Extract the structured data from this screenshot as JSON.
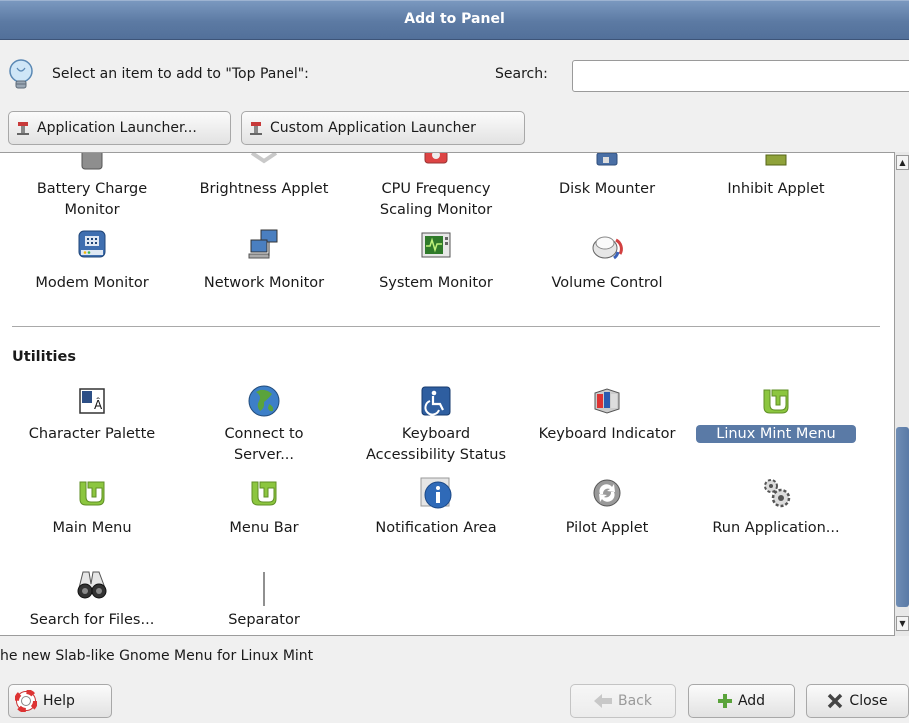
{
  "window": {
    "title": "Add to Panel"
  },
  "header": {
    "hint": "Select an item to add to \"Top Panel\":",
    "search_label": "Search:",
    "search_value": ""
  },
  "launchers": {
    "app_launcher": "Application Launcher...",
    "custom_launcher": "Custom Application Launcher"
  },
  "list": {
    "row1": [
      {
        "label1": "Battery Charge",
        "label2": "Monitor",
        "icon": "battery-icon"
      },
      {
        "label1": "Brightness Applet",
        "label2": "",
        "icon": "brightness-icon"
      },
      {
        "label1": "CPU Frequency",
        "label2": "Scaling Monitor",
        "icon": "cpu-frequency-icon"
      },
      {
        "label1": "Disk Mounter",
        "label2": "",
        "icon": "disk-mounter-icon"
      },
      {
        "label1": "Inhibit Applet",
        "label2": "",
        "icon": "inhibit-icon"
      }
    ],
    "row2": [
      {
        "label1": "Modem Monitor",
        "icon": "modem-icon"
      },
      {
        "label1": "Network Monitor",
        "icon": "network-icon"
      },
      {
        "label1": "System Monitor",
        "icon": "system-monitor-icon"
      },
      {
        "label1": "Volume Control",
        "icon": "volume-icon"
      }
    ],
    "category": "Utilities",
    "row3": [
      {
        "label1": "Character Palette",
        "label2": "",
        "icon": "character-palette-icon"
      },
      {
        "label1": "Connect to",
        "label2": "Server...",
        "icon": "globe-icon"
      },
      {
        "label1": "Keyboard",
        "label2": "Accessibility Status",
        "icon": "accessibility-icon"
      },
      {
        "label1": "Keyboard Indicator",
        "label2": "",
        "icon": "keyboard-indicator-icon"
      },
      {
        "label1": "Linux Mint Menu",
        "label2": "",
        "icon": "mint-logo-icon",
        "selected": true
      }
    ],
    "row4": [
      {
        "label1": "Main Menu",
        "icon": "mint-logo-icon"
      },
      {
        "label1": "Menu Bar",
        "icon": "mint-logo-icon"
      },
      {
        "label1": "Notification Area",
        "icon": "info-icon"
      },
      {
        "label1": "Pilot Applet",
        "icon": "pilot-icon"
      },
      {
        "label1": "Run Application...",
        "icon": "gears-icon"
      }
    ],
    "row5": [
      {
        "label1": "Search for Files...",
        "icon": "binoculars-icon"
      },
      {
        "label1": "Separator",
        "icon": "separator-icon"
      }
    ]
  },
  "description": "he new Slab-like Gnome Menu for Linux Mint",
  "footer": {
    "help": "Help",
    "back": "Back",
    "add": "Add",
    "close": "Close"
  },
  "colors": {
    "title_bar": "#5c7aa3",
    "selection": "#5a7aa6",
    "mint_green": "#8cc63f"
  }
}
